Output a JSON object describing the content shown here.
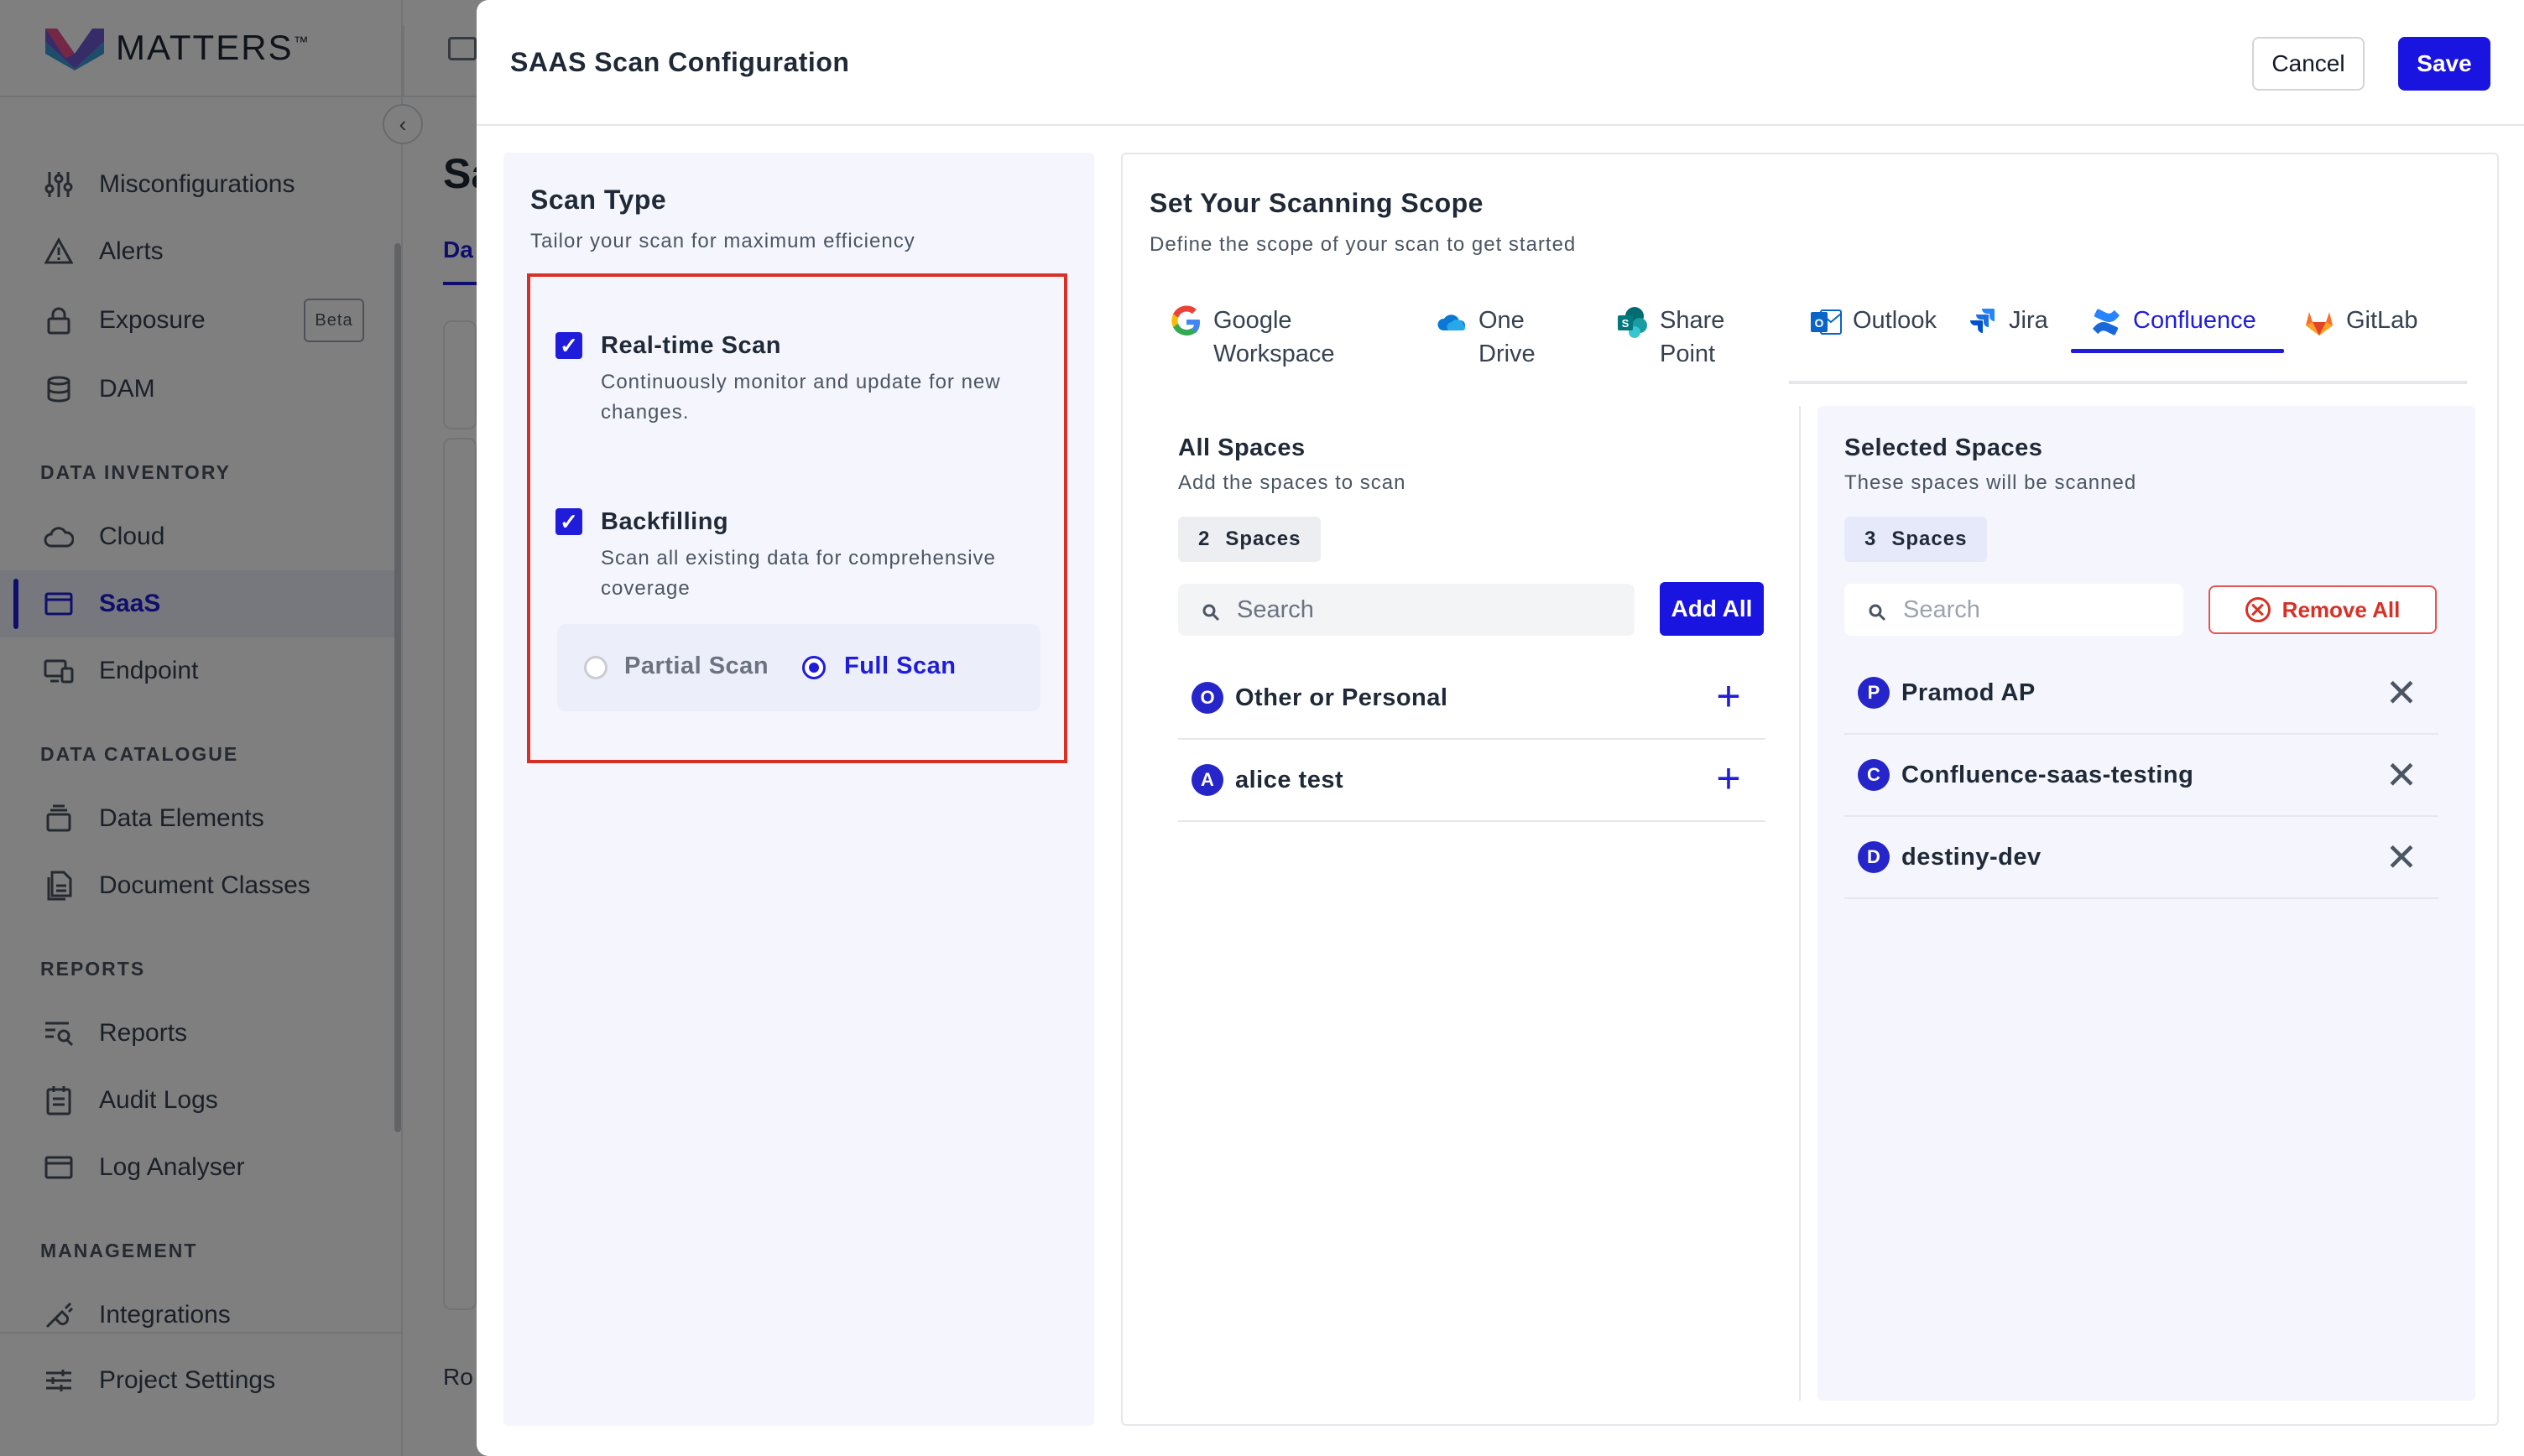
{
  "app": {
    "logo_text": "MATTERS",
    "logo_tm": "™",
    "page_title_partial": "Sa",
    "tab_partial": "Da",
    "row_partial": "Ro",
    "collapse_icon": "chevron-left-icon"
  },
  "sidebar": {
    "items": [
      {
        "label": "Misconfigurations",
        "icon": "sliders-icon"
      },
      {
        "label": "Alerts",
        "icon": "warning-icon"
      },
      {
        "label": "Exposure",
        "icon": "lock-icon",
        "badge": "Beta"
      },
      {
        "label": "DAM",
        "icon": "database-icon"
      },
      {
        "label": "Cloud",
        "icon": "cloud-icon"
      },
      {
        "label": "SaaS",
        "icon": "window-icon",
        "active": true
      },
      {
        "label": "Endpoint",
        "icon": "devices-icon"
      },
      {
        "label": "Data Elements",
        "icon": "stack-icon"
      },
      {
        "label": "Document Classes",
        "icon": "document-icon"
      },
      {
        "label": "Reports",
        "icon": "report-search-icon"
      },
      {
        "label": "Audit Logs",
        "icon": "calendar-list-icon"
      },
      {
        "label": "Log Analyser",
        "icon": "window-icon"
      },
      {
        "label": "Integrations",
        "icon": "plug-icon"
      },
      {
        "label": "Project Settings",
        "icon": "settings-sliders-icon"
      }
    ],
    "headings": {
      "inventory": "DATA INVENTORY",
      "catalogue": "DATA CATALOGUE",
      "reports": "REPORTS",
      "management": "MANAGEMENT"
    }
  },
  "modal": {
    "title": "SAAS Scan Configuration",
    "cancel_label": "Cancel",
    "save_label": "Save"
  },
  "scan_type": {
    "title": "Scan Type",
    "subtitle": "Tailor your scan for maximum efficiency",
    "realtime": {
      "title": "Real-time Scan",
      "desc": "Continuously monitor and update for new changes.",
      "checked": true
    },
    "backfilling": {
      "title": "Backfilling",
      "desc": "Scan all existing data for comprehensive coverage",
      "checked": true
    },
    "partial_label": "Partial Scan",
    "full_label": "Full Scan",
    "selected": "Full Scan"
  },
  "scope": {
    "title": "Set Your Scanning Scope",
    "subtitle": "Define the scope of your scan to get started",
    "tabs": [
      {
        "line1": "Google",
        "line2": "Workspace",
        "icon": "google-icon"
      },
      {
        "line1": "One",
        "line2": "Drive",
        "icon": "onedrive-icon"
      },
      {
        "line1": "Share",
        "line2": "Point",
        "icon": "sharepoint-icon"
      },
      {
        "line1": "Outlook",
        "line2": "",
        "icon": "outlook-icon"
      },
      {
        "line1": "Jira",
        "line2": "",
        "icon": "jira-icon"
      },
      {
        "line1": "Confluence",
        "line2": "",
        "icon": "confluence-icon",
        "active": true
      },
      {
        "line1": "GitLab",
        "line2": "",
        "icon": "gitlab-icon"
      }
    ]
  },
  "all_spaces": {
    "title": "All Spaces",
    "subtitle": "Add the spaces to scan",
    "count": "2",
    "count_label": "Spaces",
    "search_placeholder": "Search",
    "add_all_label": "Add All",
    "items": [
      {
        "initial": "O",
        "name": "Other or Personal"
      },
      {
        "initial": "A",
        "name": "alice test"
      }
    ]
  },
  "selected_spaces": {
    "title": "Selected Spaces",
    "subtitle": "These spaces will be scanned",
    "count": "3",
    "count_label": "Spaces",
    "search_placeholder": "Search",
    "remove_all_label": "Remove All",
    "items": [
      {
        "initial": "P",
        "name": "Pramod AP"
      },
      {
        "initial": "C",
        "name": "Confluence-saas-testing"
      },
      {
        "initial": "D",
        "name": "destiny-dev"
      }
    ]
  },
  "colors": {
    "primary": "#1a14e0",
    "danger": "#d93025",
    "highlight": "#d93025"
  }
}
